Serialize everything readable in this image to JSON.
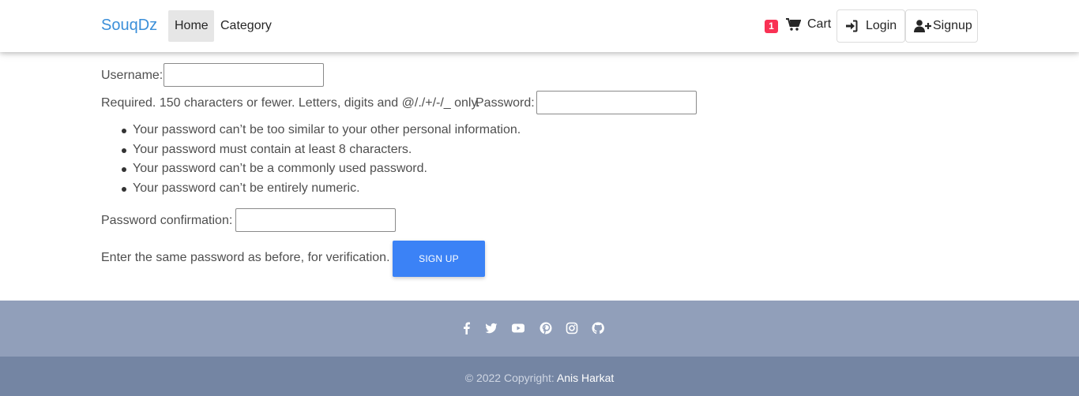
{
  "navbar": {
    "brand": "SouqDz",
    "links": [
      "Home",
      "Category"
    ],
    "cart_count": "1",
    "cart_label": "Cart",
    "login_label": "Login",
    "signup_label": "Signup"
  },
  "form": {
    "username_label": "Username:",
    "username_help": "Required. 150 characters or fewer. Letters, digits and @/./+/-/_ only.",
    "password_label": "Password:",
    "password_rules": [
      "Your password can’t be too similar to your other personal information.",
      "Your password must contain at least 8 characters.",
      "Your password can’t be a commonly used password.",
      "Your password can’t be entirely numeric."
    ],
    "confirm_label": "Password confirmation:",
    "confirm_help": "Enter the same password as before, for verification.",
    "submit_label": "Sign up"
  },
  "footer": {
    "social_icons": [
      "facebook-icon",
      "twitter-icon",
      "youtube-icon",
      "pinterest-icon",
      "instagram-icon",
      "github-icon"
    ],
    "copyright": "© 2022 Copyright:",
    "author": "Anis Harkat"
  },
  "colors": {
    "brand": "#3b8fd9",
    "primary_button": "#3b82f6",
    "badge": "#f93154",
    "footer_top": "#919fba",
    "footer_bottom": "#7485a3"
  }
}
